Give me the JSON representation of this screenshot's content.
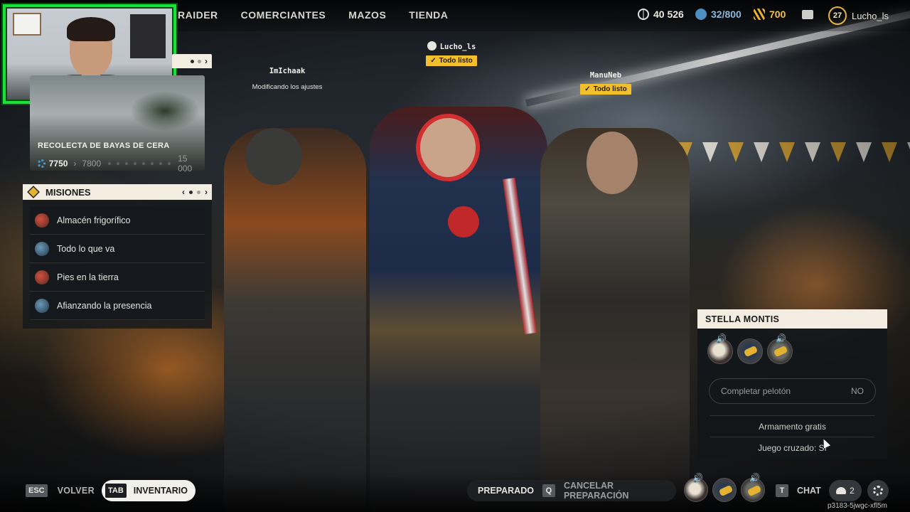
{
  "nav": {
    "items": [
      "RAIDER",
      "COMERCIANTES",
      "MAZOS",
      "TIENDA"
    ]
  },
  "currencies": {
    "coins": "40 526",
    "tokens": "32/800",
    "gold": "700"
  },
  "profile": {
    "level": "27",
    "username": "Lucho_ls"
  },
  "event": {
    "title": "RECOLECTA DE BAYAS DE CERA",
    "current": "7750",
    "target": "7800",
    "max": "15 000"
  },
  "missions": {
    "title": "MISIONES",
    "items": [
      {
        "label": "Almacén frigorífico",
        "icon": "red-mission-icon"
      },
      {
        "label": "Todo lo que va",
        "icon": "blue-mission-icon"
      },
      {
        "label": "Pies en la tierra",
        "icon": "red-mission-icon"
      },
      {
        "label": "Afianzando la presencia",
        "icon": "blue-mission-icon"
      }
    ]
  },
  "players": {
    "leader": {
      "name": "Lucho_ls",
      "status": "Todo listo"
    },
    "left": {
      "name": "ImIchaak",
      "status": "Modificando los ajustes"
    },
    "right": {
      "name": "ManuNeb",
      "status": "Todo listo"
    }
  },
  "squad": {
    "title": "STELLA MONTIS",
    "fill_label": "Completar pelotón",
    "fill_value": "NO",
    "option_loadout": "Armamento gratis",
    "option_crossplay": "Juego cruzado: Sí"
  },
  "bottom": {
    "back_key": "ESC",
    "back_label": "VOLVER",
    "inv_key": "TAB",
    "inv_label": "INVENTARIO",
    "ready_label": "PREPARADO",
    "cancel_key": "Q",
    "cancel_label": "CANCELAR PREPARACIÓN",
    "chat_key": "T",
    "chat_label": "CHAT",
    "party_count": "2"
  },
  "session_id": "p3183-5jwgc-xfl5m",
  "colors": {
    "accent_yellow": "#f2c02c",
    "panel_header": "#f2ede0",
    "webcam_border": "#18e13a"
  }
}
